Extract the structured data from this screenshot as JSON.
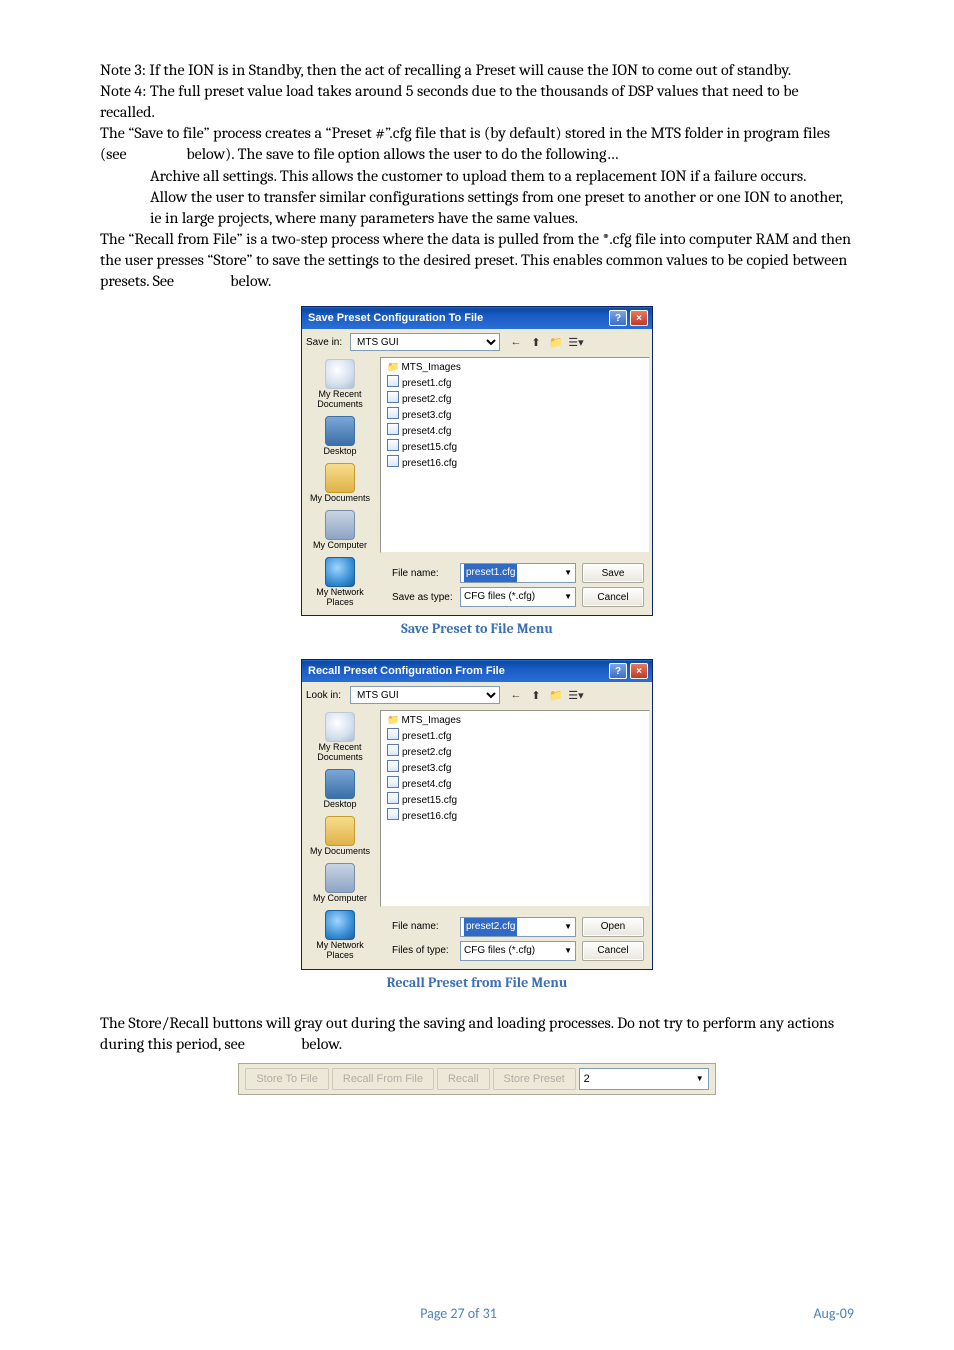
{
  "paragraphs": {
    "note3": "Note 3: If the ION is in Standby, then the act of recalling a Preset will cause the ION to come out of standby.",
    "note4": "Note 4: The full preset value load takes around 5 seconds due to the thousands of DSP values that need to be recalled.",
    "save_intro": "The “Save to file” process creates a “Preset #”.cfg file that is (by default) stored in the MTS folder in program files (see                 below). The save to file option allows the user to do the following…",
    "bullet1": "Archive all settings. This allows the customer to upload them to a replacement ION if a failure occurs.",
    "bullet2": "Allow the user to transfer similar configurations settings from one preset to another or one ION to another, ie in large projects, where many parameters have the same values.",
    "recall_para": "The “Recall from File” is a two-step process where the data is pulled from the *.cfg file into computer RAM and then the user presses “Store” to save the settings to the desired preset. This enables common values to be copied between presets. See                below.",
    "finale": "The Store/Recall buttons will gray out during the saving and loading processes. Do not try to perform any actions during this period, see                below."
  },
  "captions": {
    "save": "Save Preset to File Menu",
    "recall": "Recall Preset from File Menu"
  },
  "dialog_save": {
    "title": "Save Preset Configuration To File",
    "lookin_label": "Save in:",
    "lookin_value": "MTS GUI",
    "files": [
      "MTS_Images",
      "preset1.cfg",
      "preset2.cfg",
      "preset3.cfg",
      "preset4.cfg",
      "preset15.cfg",
      "preset16.cfg"
    ],
    "filename_label": "File name:",
    "filename_value": "preset1.cfg",
    "type_label": "Save as type:",
    "type_value": "CFG files (*.cfg)",
    "ok_btn": "Save",
    "cancel_btn": "Cancel"
  },
  "dialog_recall": {
    "title": "Recall Preset Configuration From File",
    "lookin_label": "Look in:",
    "lookin_value": "MTS GUI",
    "files": [
      "MTS_Images",
      "preset1.cfg",
      "preset2.cfg",
      "preset3.cfg",
      "preset4.cfg",
      "preset15.cfg",
      "preset16.cfg"
    ],
    "filename_label": "File name:",
    "filename_value": "preset2.cfg",
    "type_label": "Files of type:",
    "type_value": "CFG files (*.cfg)",
    "ok_btn": "Open",
    "cancel_btn": "Cancel"
  },
  "places": {
    "recent": "My Recent Documents",
    "desktop": "Desktop",
    "docs": "My Documents",
    "computer": "My Computer",
    "network": "My Network Places"
  },
  "status": {
    "store_file": "Store To File",
    "recall_file": "Recall From File",
    "recall": "Recall",
    "store_preset": "Store Preset",
    "preset_num": "2"
  },
  "footer": {
    "page": "Page 27 of 31",
    "date": "Aug-09"
  }
}
